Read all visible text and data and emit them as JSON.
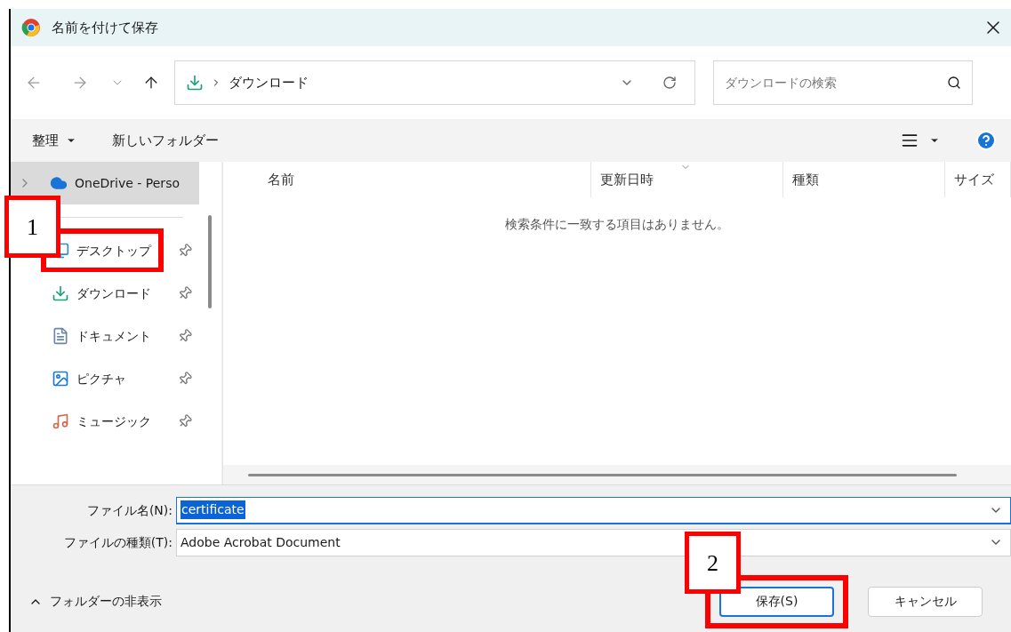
{
  "window": {
    "title": "名前を付けて保存"
  },
  "address_bar": {
    "location": "ダウンロード"
  },
  "search": {
    "placeholder": "ダウンロードの検索"
  },
  "toolbar": {
    "organize": "整理",
    "new_folder": "新しいフォルダー"
  },
  "sidebar": {
    "items": [
      {
        "label": "OneDrive - Perso",
        "kind": "cloud",
        "selected": true,
        "pinned": false,
        "expandable": true,
        "highlighted": false
      },
      {
        "label": "デスクトップ",
        "kind": "desktop",
        "selected": false,
        "pinned": true,
        "expandable": false,
        "highlighted": true
      },
      {
        "label": "ダウンロード",
        "kind": "download",
        "selected": false,
        "pinned": true,
        "expandable": false,
        "highlighted": false
      },
      {
        "label": "ドキュメント",
        "kind": "document",
        "selected": false,
        "pinned": true,
        "expandable": false,
        "highlighted": false
      },
      {
        "label": "ピクチャ",
        "kind": "picture",
        "selected": false,
        "pinned": true,
        "expandable": false,
        "highlighted": false
      },
      {
        "label": "ミュージック",
        "kind": "music",
        "selected": false,
        "pinned": true,
        "expandable": false,
        "highlighted": false
      }
    ]
  },
  "table": {
    "columns": [
      "名前",
      "更新日時",
      "種類",
      "サイズ"
    ],
    "empty_message": "検索条件に一致する項目はありません。"
  },
  "form": {
    "file_name_label": "ファイル名(N):",
    "file_name": "certificate",
    "file_type_label": "ファイルの種類(T):",
    "file_type": "Adobe Acrobat Document"
  },
  "footer": {
    "hide_folders": "フォルダーの非表示",
    "buttons": [
      {
        "label": "保存(S)",
        "kind": "primary",
        "highlighted": true
      },
      {
        "label": "キャンセル",
        "kind": "secondary",
        "highlighted": false
      }
    ]
  },
  "callouts": [
    {
      "label": "1"
    },
    {
      "label": "2"
    }
  ]
}
